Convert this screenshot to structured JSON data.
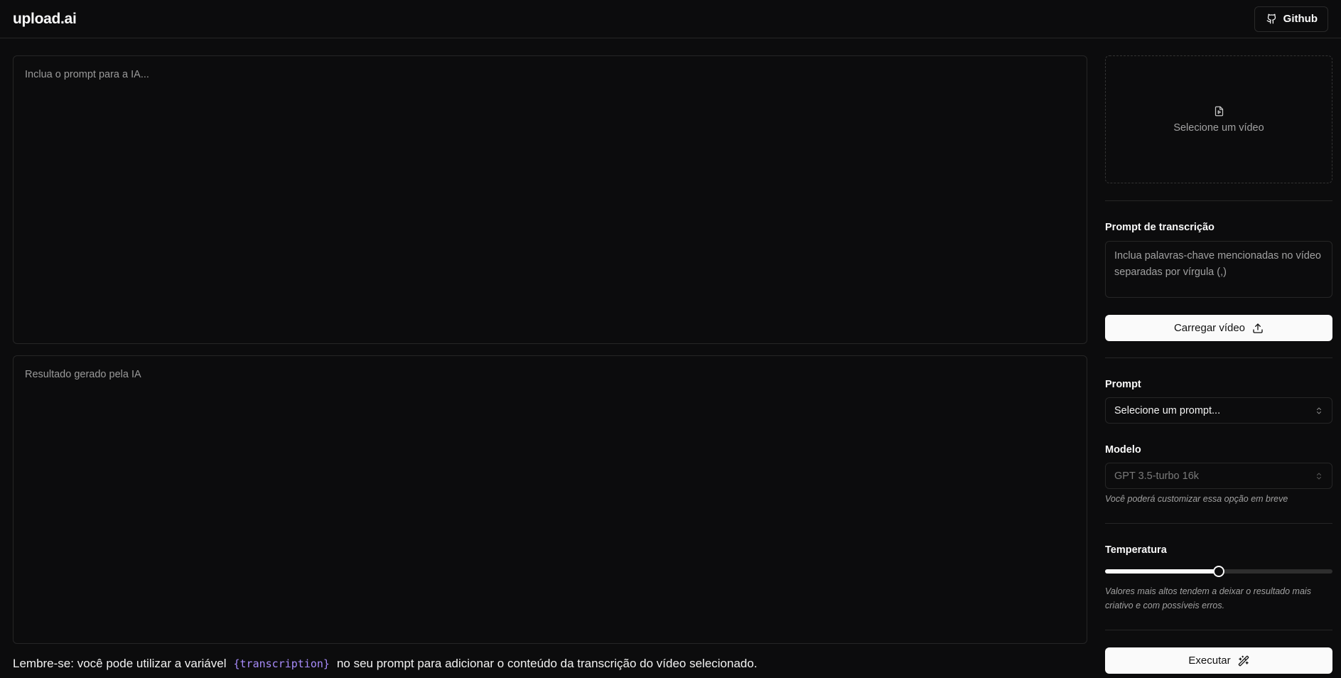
{
  "header": {
    "logo": "upload.ai",
    "github_label": "Github"
  },
  "main": {
    "prompt_placeholder": "Inclua o prompt para a IA...",
    "result_placeholder": "Resultado gerado pela IA",
    "reminder_before": "Lembre-se: você pode utilizar a variável",
    "reminder_variable": "{transcription}",
    "reminder_after": "no seu prompt para adicionar o conteúdo da transcrição do vídeo selecionado."
  },
  "sidebar": {
    "video_select_label": "Selecione um vídeo",
    "transcription_prompt_label": "Prompt de transcrição",
    "transcription_prompt_placeholder": "Inclua palavras-chave mencionadas no vídeo separadas por vírgula (,)",
    "upload_button": "Carregar vídeo",
    "prompt_label": "Prompt",
    "prompt_select_value": "Selecione um prompt...",
    "model_label": "Modelo",
    "model_select_value": "GPT 3.5-turbo 16k",
    "model_hint": "Você poderá customizar essa opção em breve",
    "temperature_label": "Temperatura",
    "temperature_value": 0.5,
    "temperature_hint": "Valores mais altos tendem a deixar o resultado mais criativo e com possíveis erros.",
    "execute_button": "Executar"
  },
  "icons": {
    "github": "github-icon",
    "file_video": "file-video-icon",
    "upload": "upload-icon",
    "chevrons": "chevrons-up-down-icon",
    "wand": "wand-icon"
  }
}
